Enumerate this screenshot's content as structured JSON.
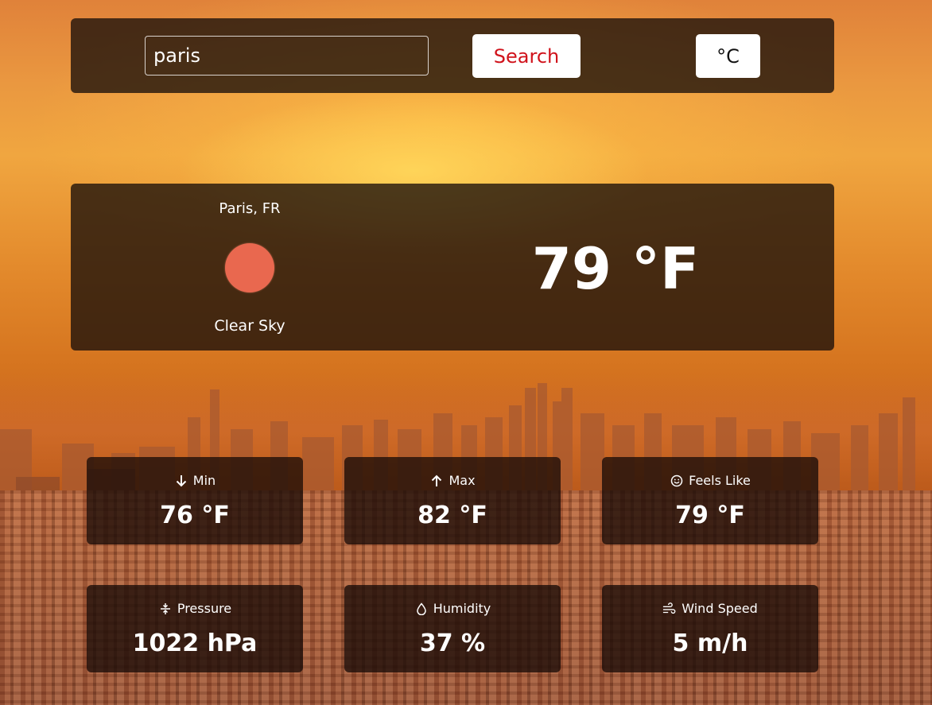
{
  "search": {
    "value": "paris",
    "button_label": "Search",
    "unit_toggle_label": "°C"
  },
  "current": {
    "location": "Paris, FR",
    "icon": "clear-sky-sun-icon",
    "condition": "Clear Sky",
    "temperature": "79 °F"
  },
  "stats": [
    {
      "label": "Min",
      "icon": "arrow-down-icon",
      "value": "76 °F"
    },
    {
      "label": "Max",
      "icon": "arrow-up-icon",
      "value": "82 °F"
    },
    {
      "label": "Feels Like",
      "icon": "smile-icon",
      "value": "79 °F"
    },
    {
      "label": "Pressure",
      "icon": "pressure-icon",
      "value": "1022 hPa"
    },
    {
      "label": "Humidity",
      "icon": "droplet-icon",
      "value": "37 %"
    },
    {
      "label": "Wind Speed",
      "icon": "wind-icon",
      "value": "5 m/h"
    }
  ],
  "colors": {
    "search_button_text": "#d0121b",
    "sun": "#e9684f",
    "panel": "rgba(25,15,10,0.78)"
  }
}
